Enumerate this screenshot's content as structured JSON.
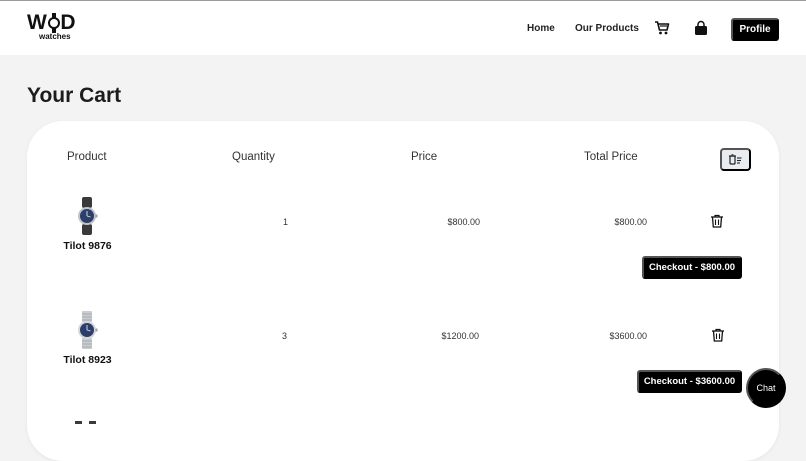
{
  "brand": {
    "name_pre": "W",
    "name_post": "D",
    "tagline": "watches"
  },
  "nav": {
    "home": "Home",
    "products": "Our Products",
    "profile": "Profile"
  },
  "icons": {
    "cart": "cart-icon",
    "bag": "shopping-bag-icon",
    "clear": "clear-cart-icon",
    "trash": "trash-icon"
  },
  "page": {
    "title": "Your Cart"
  },
  "table": {
    "headers": {
      "product": "Product",
      "quantity": "Quantity",
      "price": "Price",
      "total": "Total Price"
    },
    "rows": [
      {
        "name": "Tilot 9876",
        "quantity": "1",
        "price": "$800.00",
        "total": "$800.00",
        "checkout": "Checkout - $800.00",
        "strap": "leather"
      },
      {
        "name": "Tilot 8923",
        "quantity": "3",
        "price": "$1200.00",
        "total": "$3600.00",
        "checkout": "Checkout - $3600.00",
        "strap": "steel"
      }
    ]
  },
  "chat": {
    "label": "Chat"
  },
  "colors": {
    "accent": "#000000",
    "background": "#f3f3f3",
    "card": "#ffffff",
    "dial": "#2c3f6b"
  }
}
